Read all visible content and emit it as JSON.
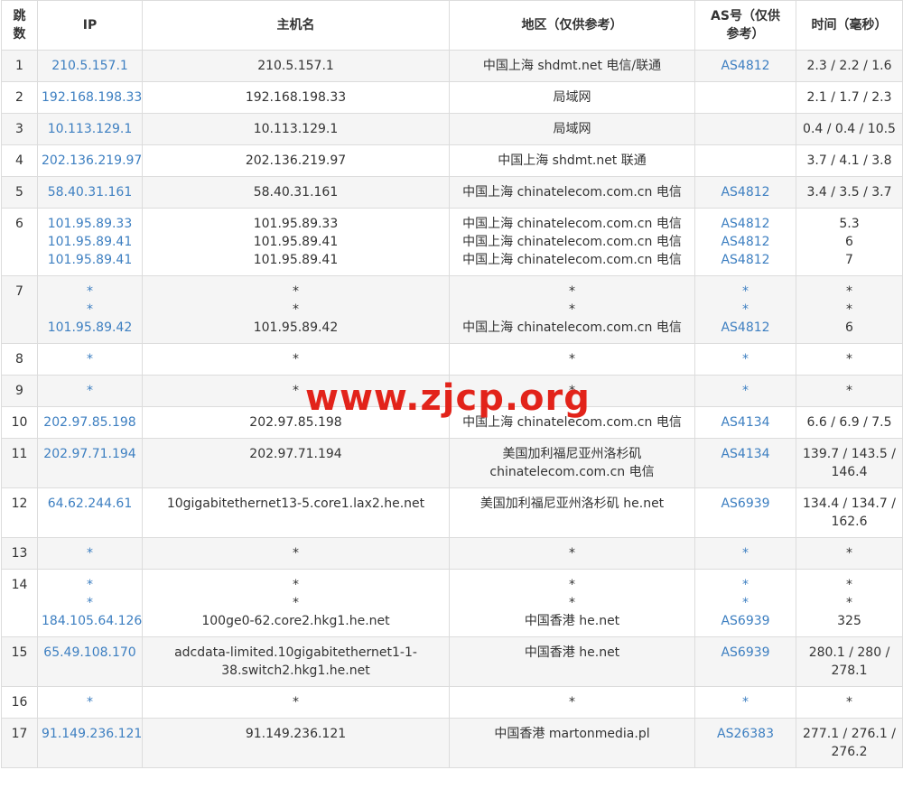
{
  "headers": {
    "hop": "跳数",
    "ip": "IP",
    "host": "主机名",
    "region": "地区（仅供参考）",
    "as": "AS号（仅供参考）",
    "time": "时间（毫秒）"
  },
  "rows": [
    {
      "hop": "1",
      "ip": [
        "210.5.157.1"
      ],
      "host": [
        "210.5.157.1"
      ],
      "region": [
        "中国上海 shdmt.net 电信/联通"
      ],
      "as": [
        "AS4812"
      ],
      "time": [
        "2.3 / 2.2 / 1.6"
      ]
    },
    {
      "hop": "2",
      "ip": [
        "192.168.198.33"
      ],
      "host": [
        "192.168.198.33"
      ],
      "region": [
        "局域网"
      ],
      "as": [
        ""
      ],
      "time": [
        "2.1 / 1.7 / 2.3"
      ]
    },
    {
      "hop": "3",
      "ip": [
        "10.113.129.1"
      ],
      "host": [
        "10.113.129.1"
      ],
      "region": [
        "局域网"
      ],
      "as": [
        ""
      ],
      "time": [
        "0.4 / 0.4 / 10.5"
      ]
    },
    {
      "hop": "4",
      "ip": [
        "202.136.219.97"
      ],
      "host": [
        "202.136.219.97"
      ],
      "region": [
        "中国上海 shdmt.net 联通"
      ],
      "as": [
        ""
      ],
      "time": [
        "3.7 / 4.1 / 3.8"
      ]
    },
    {
      "hop": "5",
      "ip": [
        "58.40.31.161"
      ],
      "host": [
        "58.40.31.161"
      ],
      "region": [
        "中国上海 chinatelecom.com.cn 电信"
      ],
      "as": [
        "AS4812"
      ],
      "time": [
        "3.4 / 3.5 / 3.7"
      ]
    },
    {
      "hop": "6",
      "ip": [
        "101.95.89.33",
        "101.95.89.41",
        "101.95.89.41"
      ],
      "host": [
        "101.95.89.33",
        "101.95.89.41",
        "101.95.89.41"
      ],
      "region": [
        "中国上海 chinatelecom.com.cn 电信",
        "中国上海 chinatelecom.com.cn 电信",
        "中国上海 chinatelecom.com.cn 电信"
      ],
      "as": [
        "AS4812",
        "AS4812",
        "AS4812"
      ],
      "time": [
        "5.3",
        "6",
        "7"
      ]
    },
    {
      "hop": "7",
      "ip": [
        "*",
        "*",
        "101.95.89.42"
      ],
      "host": [
        "*",
        "*",
        "101.95.89.42"
      ],
      "region": [
        "*",
        "*",
        "中国上海 chinatelecom.com.cn 电信"
      ],
      "as": [
        "*",
        "*",
        "AS4812"
      ],
      "time": [
        "*",
        "*",
        "6"
      ]
    },
    {
      "hop": "8",
      "ip": [
        "*"
      ],
      "host": [
        "*"
      ],
      "region": [
        "*"
      ],
      "as": [
        "*"
      ],
      "time": [
        "*"
      ]
    },
    {
      "hop": "9",
      "ip": [
        "*"
      ],
      "host": [
        "*"
      ],
      "region": [
        "*"
      ],
      "as": [
        "*"
      ],
      "time": [
        "*"
      ]
    },
    {
      "hop": "10",
      "ip": [
        "202.97.85.198"
      ],
      "host": [
        "202.97.85.198"
      ],
      "region": [
        "中国上海 chinatelecom.com.cn 电信"
      ],
      "as": [
        "AS4134"
      ],
      "time": [
        "6.6 / 6.9 / 7.5"
      ]
    },
    {
      "hop": "11",
      "ip": [
        "202.97.71.194"
      ],
      "host": [
        "202.97.71.194"
      ],
      "region": [
        "美国加利福尼亚州洛杉矶",
        "chinatelecom.com.cn 电信"
      ],
      "as": [
        "AS4134"
      ],
      "time": [
        "139.7 / 143.5 /",
        "146.4"
      ]
    },
    {
      "hop": "12",
      "ip": [
        "64.62.244.61"
      ],
      "host": [
        "10gigabitethernet13-5.core1.lax2.he.net"
      ],
      "region": [
        "美国加利福尼亚州洛杉矶 he.net"
      ],
      "as": [
        "AS6939"
      ],
      "time": [
        "134.4 / 134.7 /",
        "162.6"
      ]
    },
    {
      "hop": "13",
      "ip": [
        "*"
      ],
      "host": [
        "*"
      ],
      "region": [
        "*"
      ],
      "as": [
        "*"
      ],
      "time": [
        "*"
      ]
    },
    {
      "hop": "14",
      "ip": [
        "*",
        "*",
        "184.105.64.126"
      ],
      "host": [
        "*",
        "*",
        "100ge0-62.core2.hkg1.he.net"
      ],
      "region": [
        "*",
        "*",
        "中国香港 he.net"
      ],
      "as": [
        "*",
        "*",
        "AS6939"
      ],
      "time": [
        "*",
        "*",
        "325"
      ]
    },
    {
      "hop": "15",
      "ip": [
        "65.49.108.170"
      ],
      "host": [
        "adcdata-limited.10gigabitethernet1-1-",
        "38.switch2.hkg1.he.net"
      ],
      "region": [
        "中国香港 he.net"
      ],
      "as": [
        "AS6939"
      ],
      "time": [
        "280.1 / 280 /",
        "278.1"
      ]
    },
    {
      "hop": "16",
      "ip": [
        "*"
      ],
      "host": [
        "*"
      ],
      "region": [
        "*"
      ],
      "as": [
        "*"
      ],
      "time": [
        "*"
      ]
    },
    {
      "hop": "17",
      "ip": [
        "91.149.236.121"
      ],
      "host": [
        "91.149.236.121"
      ],
      "region": [
        "中国香港 martonmedia.pl"
      ],
      "as": [
        "AS26383"
      ],
      "time": [
        "277.1 / 276.1 /",
        "276.2"
      ]
    }
  ],
  "watermark": "www.zjcp.org",
  "colors": {
    "link": "#3d7fc1",
    "stripe": "#f5f5f5",
    "border": "#dcdcdc",
    "watermark": "#e2231a"
  }
}
